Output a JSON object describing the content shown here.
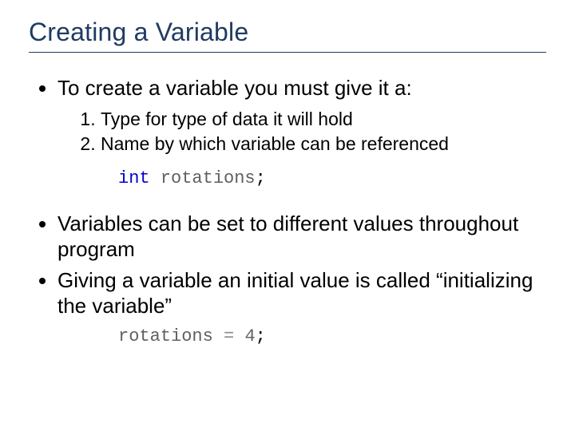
{
  "title": "Creating a Variable",
  "bullets": {
    "b1": "To create a variable you must give it a:",
    "sub1": "Type for type of data it will hold",
    "sub2": "Name by which variable can be referenced",
    "b2": "Variables can be set to different values throughout program",
    "b3": "Giving a variable an initial value is called “initializing the variable”"
  },
  "code1": {
    "kw": "int",
    "ident": "rotations",
    "semi": ";"
  },
  "code2": {
    "ident": "rotations",
    "op": "=",
    "val": "4",
    "semi": ";"
  }
}
